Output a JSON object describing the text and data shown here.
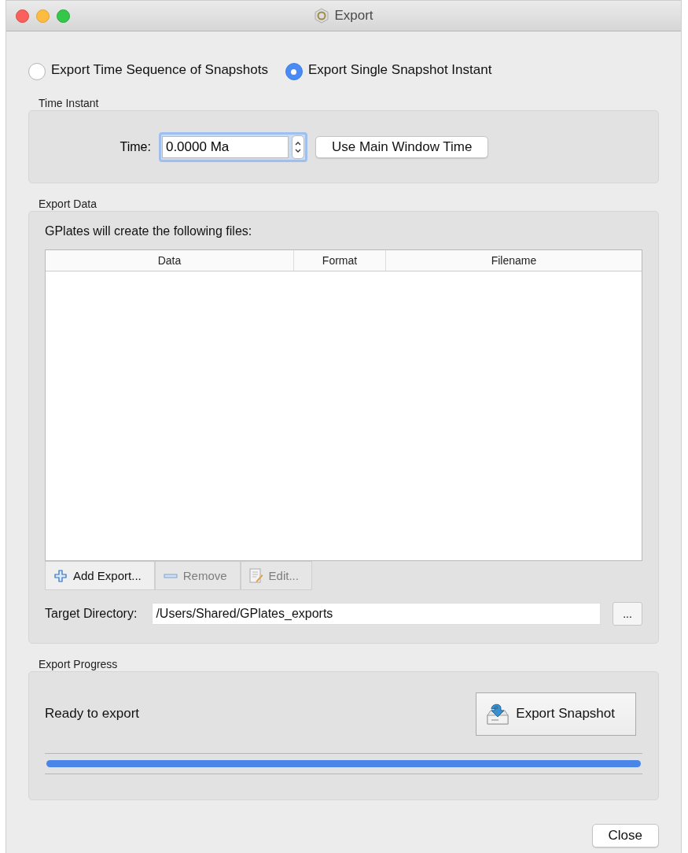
{
  "window": {
    "title": "Export"
  },
  "modes": [
    {
      "label": "Export Time Sequence of Snapshots",
      "selected": false
    },
    {
      "label": "Export Single Snapshot Instant",
      "selected": true
    }
  ],
  "time_instant": {
    "title": "Time Instant",
    "label": "Time:",
    "value": "0.0000 Ma",
    "button": "Use Main Window Time"
  },
  "export_data": {
    "title": "Export Data",
    "intro": "GPlates will create the following files:",
    "columns": [
      "Data",
      "Format",
      "Filename"
    ],
    "buttons": [
      {
        "label": "Add Export...",
        "kind": "add",
        "disabled": false
      },
      {
        "label": "Remove",
        "kind": "remove",
        "disabled": true
      },
      {
        "label": "Edit...",
        "kind": "edit",
        "disabled": true
      }
    ],
    "target_label": "Target Directory:",
    "target_value": "/Users/Shared/GPlates_exports",
    "browse": "..."
  },
  "export_progress": {
    "title": "Export Progress",
    "status": "Ready to export",
    "button": "Export Snapshot",
    "level": 1
  },
  "close": "Close"
}
